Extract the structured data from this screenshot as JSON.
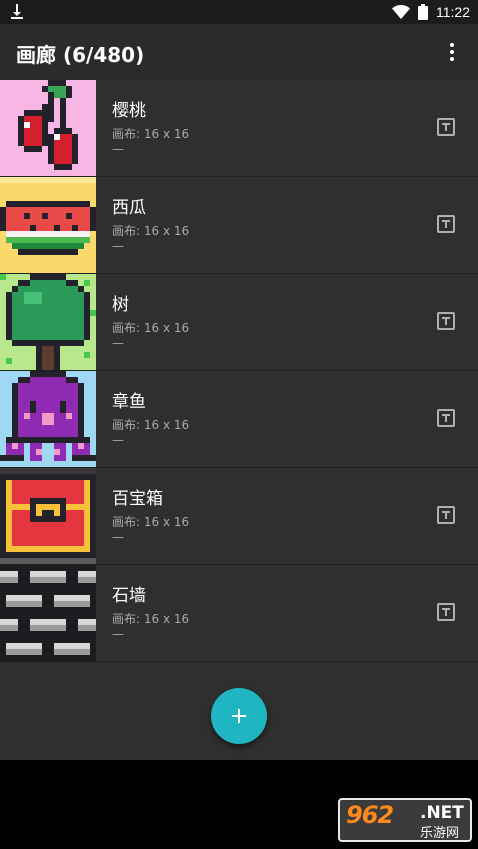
{
  "status_bar": {
    "time": "11:22"
  },
  "app_bar": {
    "title": "画廊 (6/480)"
  },
  "gallery": [
    {
      "name": "樱桃",
      "canvas": "画布: 16 x 16",
      "extra": "—",
      "thumb": "cherry"
    },
    {
      "name": "西瓜",
      "canvas": "画布: 16 x 16",
      "extra": "—",
      "thumb": "watermelon"
    },
    {
      "name": "树",
      "canvas": "画布: 16 x 16",
      "extra": "—",
      "thumb": "tree"
    },
    {
      "name": "章鱼",
      "canvas": "画布: 16 x 16",
      "extra": "—",
      "thumb": "octopus"
    },
    {
      "name": "百宝箱",
      "canvas": "画布: 16 x 16",
      "extra": "—",
      "thumb": "treasure-chest"
    },
    {
      "name": "石墙",
      "canvas": "画布: 16 x 16",
      "extra": "—",
      "thumb": "stone-wall"
    }
  ],
  "watermark": {
    "brand": "962",
    "suffix": ".NET",
    "sub": "乐游网"
  },
  "colors": {
    "accent": "#1fb6c1",
    "list_bg": "#2f2f2f",
    "app_bar": "#2b2b2b"
  }
}
